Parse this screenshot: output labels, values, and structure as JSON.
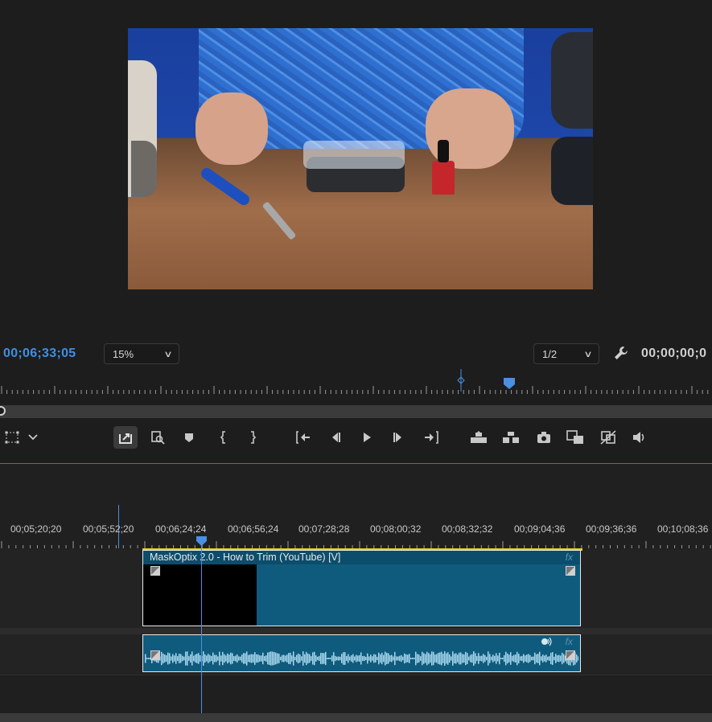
{
  "program_monitor": {
    "current_timecode": "00;06;33;05",
    "zoom": "15%",
    "resolution": "1/2",
    "duration_timecode": "00;00;00;0"
  },
  "transport_buttons": [
    {
      "name": "transform-icon"
    },
    {
      "name": "chevron-down-icon"
    },
    {
      "name": "export-frame-active-icon"
    },
    {
      "name": "zoom-icon"
    },
    {
      "name": "add-marker-icon"
    },
    {
      "name": "mark-in-icon"
    },
    {
      "name": "mark-out-icon"
    },
    {
      "name": "go-to-in-icon"
    },
    {
      "name": "step-back-icon"
    },
    {
      "name": "play-icon"
    },
    {
      "name": "step-forward-icon"
    },
    {
      "name": "go-to-out-icon"
    },
    {
      "name": "lift-icon"
    },
    {
      "name": "extract-icon"
    },
    {
      "name": "camera-icon"
    },
    {
      "name": "compare-view-icon"
    },
    {
      "name": "proxy-toggle-icon"
    },
    {
      "name": "volume-icon"
    }
  ],
  "timeline": {
    "ruler_labels": [
      "00;05;20;20",
      "00;05;52;20",
      "00;06;24;24",
      "00;06;56;24",
      "00;07;28;28",
      "00;08;00;32",
      "00;08;32;32",
      "00;09;04;36",
      "00;09;36;36",
      "00;10;08;36"
    ],
    "video_clip": {
      "name": "MaskOptix 2.0 - How to Trim (YouTube) [V]",
      "fx": "fx"
    },
    "audio_clip": {
      "fx": "fx"
    }
  },
  "colors": {
    "accent_blue": "#4a90e2",
    "clip_teal": "#0f5b7d",
    "selection_yellow": "#e6d21a"
  }
}
